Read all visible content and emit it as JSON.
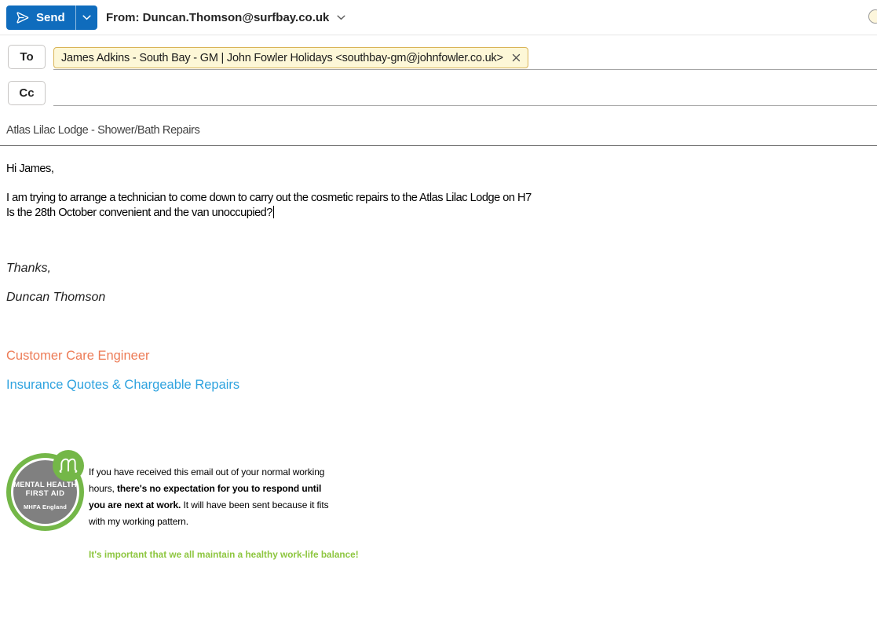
{
  "header": {
    "send_label": "Send",
    "from_line": "From: Duncan.Thomson@surfbay.co.uk"
  },
  "recipients": {
    "to_label": "To",
    "cc_label": "Cc",
    "to_chip_text": "James Adkins - South Bay - GM | John Fowler Holidays <southbay-gm@johnfowler.co.uk>"
  },
  "subject_value": "Atlas Lilac Lodge - Shower/Bath Repairs",
  "body": {
    "greeting": "Hi James,",
    "paragraph_line1": "I am trying to arrange a technician to come down to carry out the cosmetic repairs to the Atlas Lilac Lodge on H7",
    "paragraph_line2": "Is the 28th October convenient and the van unoccupied?",
    "closing": "Thanks,",
    "signature_name": "Duncan Thomson",
    "signature_role": "Customer Care Engineer",
    "signature_team": "Insurance Quotes & Chargeable Repairs"
  },
  "footer": {
    "mhfa_badge": {
      "title_line1": "MENTAL HEALTH",
      "title_line2": "FIRST AID",
      "subtitle": "MHFA England"
    },
    "working_pattern_lines": [
      {
        "normal1": "If you have received this email out of your normal working",
        "bold": "",
        "normal2": ""
      },
      {
        "normal1": "hours, ",
        "bold": "there's no expectation for you to respond until",
        "normal2": ""
      },
      {
        "normal1": "",
        "bold": "you are next at work.",
        "normal2": " It will have been sent because it fits"
      },
      {
        "normal1": "with my working pattern.",
        "bold": "",
        "normal2": ""
      }
    ],
    "balance_message": "It's important that we all maintain a healthy work-life balance!"
  },
  "colors": {
    "send_button_blue": "#0f6cbd",
    "chip_background": "#fdf7d7",
    "chip_border": "#d9b457",
    "role_orange": "#ed7c57",
    "team_blue": "#2fa3df",
    "mhfa_ring_green": "#74b748",
    "mhfa_core_gray": "#808080",
    "balance_green": "#8dc63f"
  }
}
